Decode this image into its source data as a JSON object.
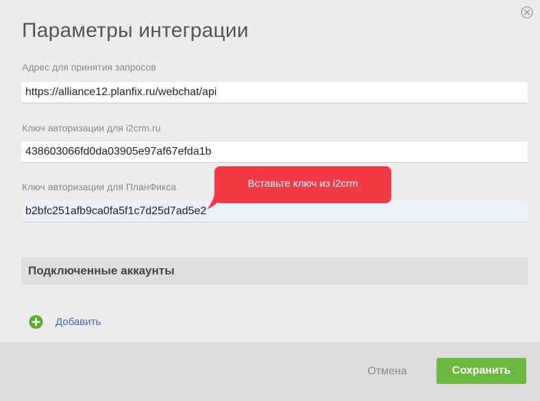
{
  "dialog": {
    "title": "Параметры интеграции",
    "close_icon": "close-circle-icon"
  },
  "fields": {
    "request_address": {
      "label": "Адрес для принятия запросов",
      "value": "https://alliance12.planfix.ru/webchat/api"
    },
    "i2crm_key": {
      "label": "Ключ авторизации для i2crm.ru",
      "value": "438603066fd0da03905e97af67efda1b"
    },
    "planfix_key": {
      "label": "Ключ авторизации для ПланФикса",
      "value": "b2bfc251afb9ca0fa5f1c7d25d7ad5e2"
    }
  },
  "tooltip": {
    "text": "Вставьте ключ из i2crm",
    "color": "#f23a46"
  },
  "accounts": {
    "section_title": "Подключенные аккаунты",
    "add_label": "Добавить",
    "add_icon": "plus-circle-icon"
  },
  "footer": {
    "cancel_label": "Отмена",
    "save_label": "Сохранить",
    "save_color": "#6ab93f"
  }
}
